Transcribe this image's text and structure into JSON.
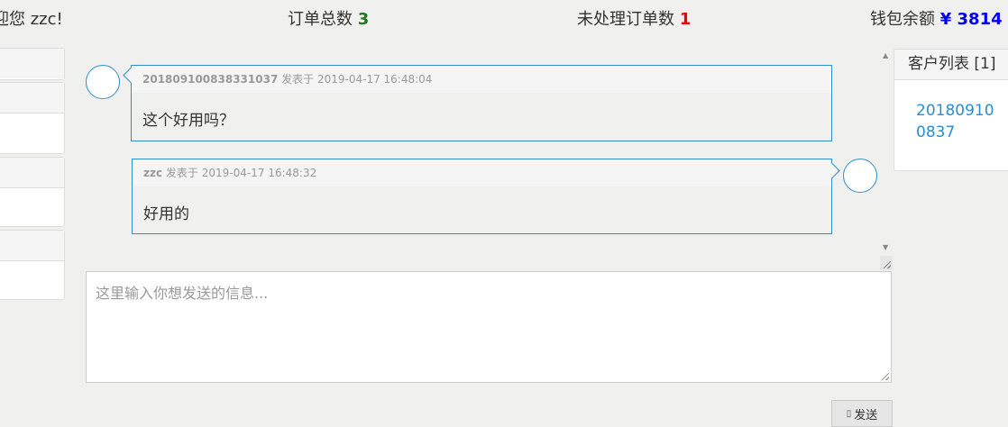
{
  "header": {
    "welcome": "迎您 zzc!",
    "orders_total_label": "订单总数",
    "orders_total_value": "3",
    "orders_pending_label": "未处理订单数",
    "orders_pending_value": "1",
    "wallet_label": "钱包余额",
    "wallet_value": "¥ 3814"
  },
  "messages": [
    {
      "sender": "201809100838331037",
      "posted_label": "发表于",
      "time": "2019-04-17 16:48:04",
      "text": "这个好用吗？",
      "side": "left"
    },
    {
      "sender": "zzc",
      "posted_label": "发表于",
      "time": "2019-04-17 16:48:32",
      "text": "好用的",
      "side": "right"
    }
  ],
  "composer": {
    "placeholder": "这里输入你想发送的信息...",
    "send_label": "发送",
    "send_icon": "send-icon"
  },
  "customers": {
    "title": "客户列表 [1]",
    "items": [
      "201809100837"
    ]
  },
  "colors": {
    "accent": "#2e8fc9",
    "count_green": "#1e7b1e",
    "count_red": "#ee0000",
    "wallet_blue": "#0000ee",
    "link": "#2a8ed0"
  }
}
